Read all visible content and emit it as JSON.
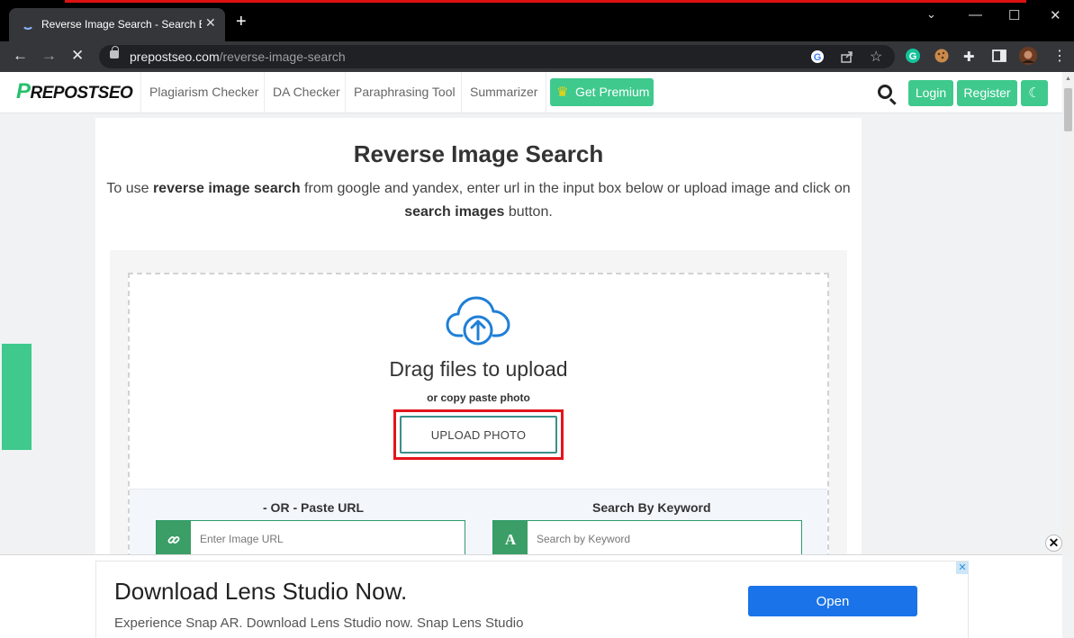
{
  "browser": {
    "tab_title": "Reverse Image Search - Search By Image",
    "tab_close": "✕",
    "new_tab": "+",
    "url_host": "prepostseo.com",
    "url_path": "/reverse-image-search",
    "window_controls": {
      "minimize": "—",
      "maximize": "☐",
      "close": "✕"
    }
  },
  "site": {
    "logo": {
      "lead": "P",
      "rest": "REPOSTSEO"
    },
    "nav": [
      "Plagiarism Checker",
      "DA Checker",
      "Paraphrasing Tool",
      "Summarizer"
    ],
    "premium_label": "Get Premium",
    "login_label": "Login",
    "register_label": "Register"
  },
  "main": {
    "title": "Reverse Image Search",
    "intro": {
      "p1": "To use ",
      "b1": "reverse image search",
      "p2": " from google and yandex, enter url in the input box below or upload image and click on ",
      "b2": "search images",
      "p3": " button."
    },
    "drag_title": "Drag files to upload",
    "drag_subtitle": "or copy paste photo",
    "upload_button": "UPLOAD PHOTO",
    "paste_url_title": "- OR - Paste URL",
    "url_placeholder": "Enter Image URL",
    "keyword_title": "Search By Keyword",
    "keyword_placeholder": "Search by Keyword",
    "keyword_badge": "A"
  },
  "ad": {
    "title": "Download Lens Studio Now.",
    "text": "Experience Snap AR. Download Lens Studio now. Snap Lens Studio",
    "cta": "Open",
    "close": "✕"
  },
  "colors": {
    "accent_green": "#3fc98d",
    "highlight_red": "#e3141c",
    "ad_button": "#1a73e8",
    "cloud_blue": "#1f7fd6"
  }
}
